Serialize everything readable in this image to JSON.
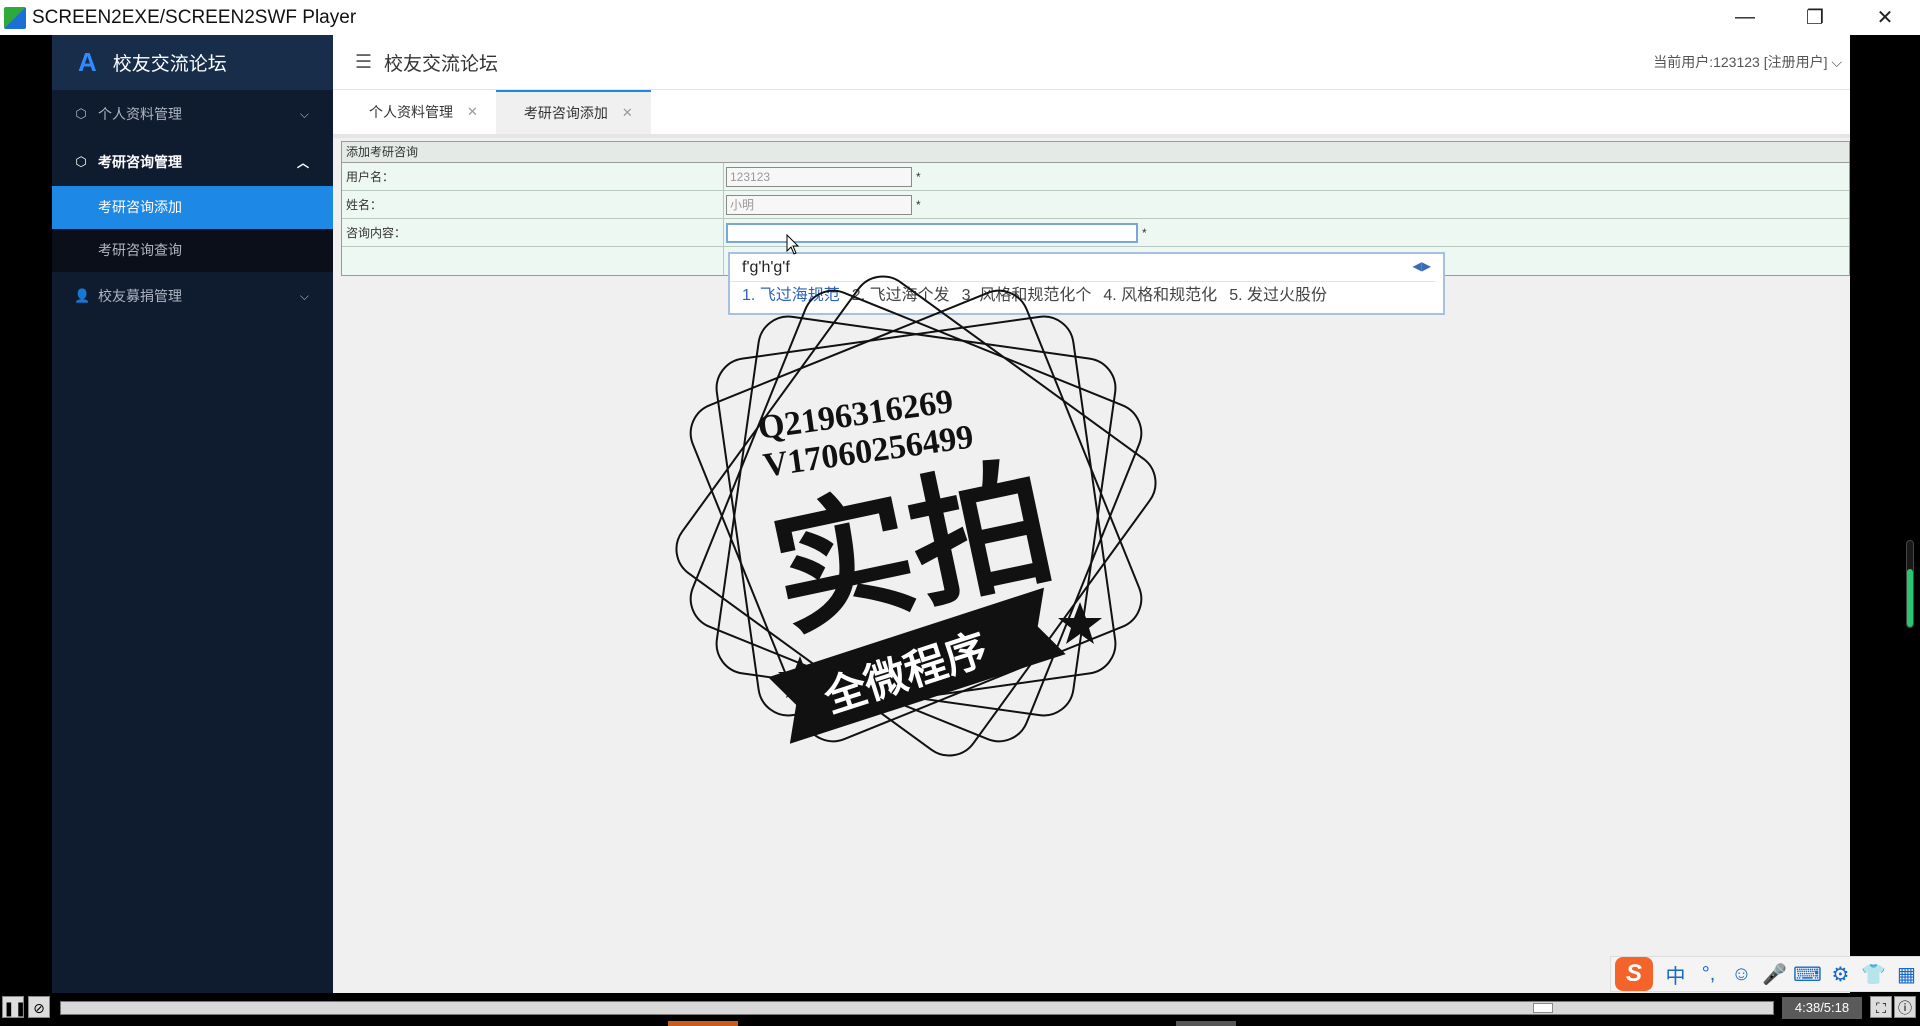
{
  "window": {
    "title": "SCREEN2EXE/SCREEN2SWF Player",
    "minimize": "—",
    "restore": "❐",
    "close": "✕"
  },
  "sidebar": {
    "brand": "校友交流论坛",
    "items": [
      {
        "label": "个人资料管理",
        "icon": "cube-icon",
        "expanded": false
      },
      {
        "label": "考研咨询管理",
        "icon": "cube-icon",
        "expanded": true,
        "children": [
          {
            "label": "考研咨询添加",
            "active": true
          },
          {
            "label": "考研咨询查询",
            "active": false
          }
        ]
      },
      {
        "label": "校友募捐管理",
        "icon": "person-icon",
        "expanded": false
      }
    ]
  },
  "header": {
    "title": "校友交流论坛",
    "user": "当前用户:123123 [注册用户]"
  },
  "tabs": [
    {
      "label": "个人资料管理",
      "active": false
    },
    {
      "label": "考研咨询添加",
      "active": true
    }
  ],
  "form": {
    "caption": "添加考研咨询",
    "fields": [
      {
        "label": "用户名：",
        "value": "123123",
        "required": "*"
      },
      {
        "label": "姓名：",
        "value": "小明",
        "required": "*"
      },
      {
        "label": "咨询内容：",
        "value": "",
        "required": "*"
      }
    ]
  },
  "ime": {
    "composition": "f'g'h'g'f",
    "candidates": [
      "1. 飞过海规范",
      "2. 飞过海个发",
      "3. 风格和规范化个",
      "4. 风格和规范化",
      "5. 发过火股份"
    ]
  },
  "watermark": {
    "line1": "Q2196316269",
    "line2": "V17060256499",
    "big": "实拍",
    "banner": "全微程序"
  },
  "player": {
    "time": "4:38/5:18",
    "progress": 0.87
  },
  "colors": {
    "sidebar_bg": "#0f1b2e",
    "accent": "#1e88e5",
    "form_row": "#eef8f3"
  }
}
